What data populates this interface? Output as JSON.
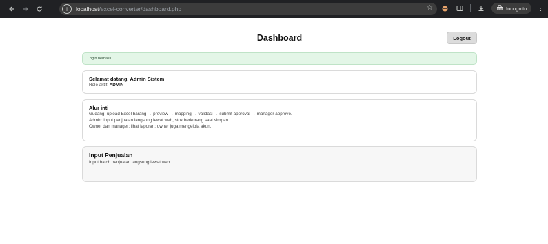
{
  "browser": {
    "url_host": "localhost",
    "url_path": "/excel-converter/dashboard.php",
    "incognito_label": "Incognito"
  },
  "page": {
    "title": "Dashboard",
    "logout_label": "Logout"
  },
  "alert": {
    "text": "Login berhasil."
  },
  "welcome": {
    "title": "Selamat datang, Admin Sistem",
    "role_prefix": "Role aktif:",
    "role_value": "ADMIN"
  },
  "flow": {
    "title": "Alur inti",
    "lines": [
      "Gudang: upload Excel barang → preview → mapping → validasi → submit approval → manager approve.",
      "Admin: input penjualan langsung lewat web, stok berkurang saat simpan.",
      "Owner dan manager: lihat laporan; owner juga mengelola akun."
    ]
  },
  "sales": {
    "title": "Input Penjualan",
    "description": "Input batch penjualan langsung lewat web."
  },
  "icons": {
    "back": "arrow-left-icon",
    "forward": "arrow-right-icon",
    "reload": "reload-icon",
    "site_info": "site-info-icon",
    "bookmark": "star-icon",
    "extension": "extension-icon",
    "sidebar": "side-panel-icon",
    "download": "download-icon",
    "incognito": "incognito-icon",
    "menu": "kebab-menu-icon"
  }
}
